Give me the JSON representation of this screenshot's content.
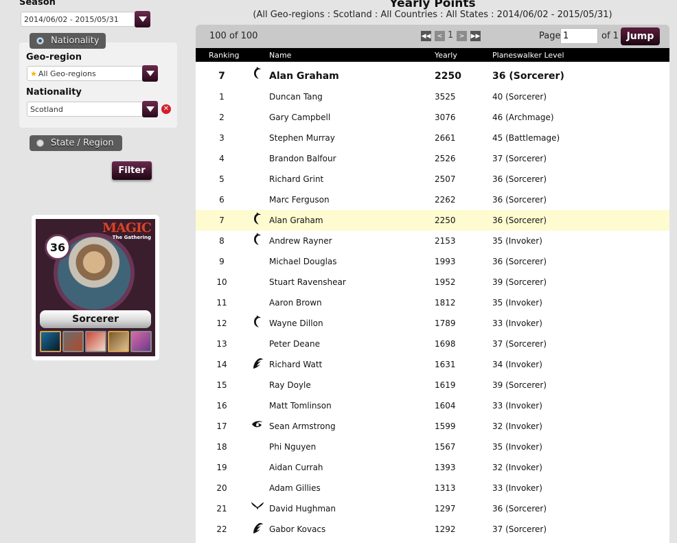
{
  "sidebar": {
    "season_label": "Season",
    "season_value": "2014/06/02 - 2015/05/31",
    "nationality_tab": "Nationality",
    "geo_region_label": "Geo-region",
    "geo_region_value": "All Geo-regions",
    "nationality_label": "Nationality",
    "nationality_value": "Scotland",
    "state_tab": "State / Region",
    "filter_button": "Filter"
  },
  "card": {
    "logo_main": "MAGIC",
    "logo_sub": "The Gathering",
    "level": "36",
    "rank_title": "Sorcerer"
  },
  "main": {
    "title": "Yearly Points",
    "subtitle": "(All Geo-regions : Scotland : All Countries : All States : 2014/06/02 - 2015/05/31)",
    "pager": {
      "count": "100 of 100",
      "current_page": "1",
      "page_label": "Page",
      "page_input": "1",
      "of_label": "of 1",
      "jump_button": "Jump"
    },
    "columns": {
      "ranking": "Ranking",
      "name": "Name",
      "yearly": "Yearly",
      "level": "Planeswalker Level"
    },
    "me": {
      "rank": "7",
      "icon": "bird-guild-icon",
      "name": "Alan Graham",
      "yearly": "2250",
      "level": "36 (Sorcerer)"
    },
    "rows": [
      {
        "rank": "1",
        "icon": "",
        "name": "Duncan Tang",
        "yearly": "3525",
        "level": "40 (Sorcerer)"
      },
      {
        "rank": "2",
        "icon": "",
        "name": "Gary Campbell",
        "yearly": "3076",
        "level": "46 (Archmage)"
      },
      {
        "rank": "3",
        "icon": "",
        "name": "Stephen Murray",
        "yearly": "2661",
        "level": "45 (Battlemage)"
      },
      {
        "rank": "4",
        "icon": "",
        "name": "Brandon Balfour",
        "yearly": "2526",
        "level": "37 (Sorcerer)"
      },
      {
        "rank": "5",
        "icon": "",
        "name": "Richard Grint",
        "yearly": "2507",
        "level": "36 (Sorcerer)"
      },
      {
        "rank": "6",
        "icon": "",
        "name": "Marc Ferguson",
        "yearly": "2262",
        "level": "36 (Sorcerer)"
      },
      {
        "rank": "7",
        "icon": "bird-guild-icon",
        "name": "Alan Graham",
        "yearly": "2250",
        "level": "36 (Sorcerer)",
        "highlight": true
      },
      {
        "rank": "8",
        "icon": "bird-guild-icon",
        "name": "Andrew Rayner",
        "yearly": "2153",
        "level": "35 (Invoker)"
      },
      {
        "rank": "9",
        "icon": "",
        "name": "Michael Douglas",
        "yearly": "1993",
        "level": "36 (Sorcerer)"
      },
      {
        "rank": "10",
        "icon": "",
        "name": "Stuart Ravenshear",
        "yearly": "1952",
        "level": "39 (Sorcerer)"
      },
      {
        "rank": "11",
        "icon": "",
        "name": "Aaron Brown",
        "yearly": "1812",
        "level": "35 (Invoker)"
      },
      {
        "rank": "12",
        "icon": "bird-guild-icon",
        "name": "Wayne Dillon",
        "yearly": "1789",
        "level": "33 (Invoker)"
      },
      {
        "rank": "13",
        "icon": "",
        "name": "Peter Deane",
        "yearly": "1698",
        "level": "37 (Sorcerer)"
      },
      {
        "rank": "14",
        "icon": "claw-guild-icon",
        "name": "Richard Watt",
        "yearly": "1631",
        "level": "34 (Invoker)"
      },
      {
        "rank": "15",
        "icon": "",
        "name": "Ray Doyle",
        "yearly": "1619",
        "level": "39 (Sorcerer)"
      },
      {
        "rank": "16",
        "icon": "",
        "name": "Matt Tomlinson",
        "yearly": "1604",
        "level": "33 (Invoker)"
      },
      {
        "rank": "17",
        "icon": "eye-guild-icon",
        "name": "Sean Armstrong",
        "yearly": "1599",
        "level": "32 (Invoker)"
      },
      {
        "rank": "18",
        "icon": "",
        "name": "Phi Nguyen",
        "yearly": "1567",
        "level": "35 (Invoker)"
      },
      {
        "rank": "19",
        "icon": "",
        "name": "Aidan Currah",
        "yearly": "1393",
        "level": "32 (Invoker)"
      },
      {
        "rank": "20",
        "icon": "",
        "name": "Adam Gillies",
        "yearly": "1313",
        "level": "33 (Invoker)"
      },
      {
        "rank": "21",
        "icon": "horns-guild-icon",
        "name": "David Hughman",
        "yearly": "1297",
        "level": "36 (Sorcerer)"
      },
      {
        "rank": "22",
        "icon": "claw-guild-icon",
        "name": "Gabor Kovacs",
        "yearly": "1292",
        "level": "37 (Sorcerer)"
      }
    ]
  }
}
